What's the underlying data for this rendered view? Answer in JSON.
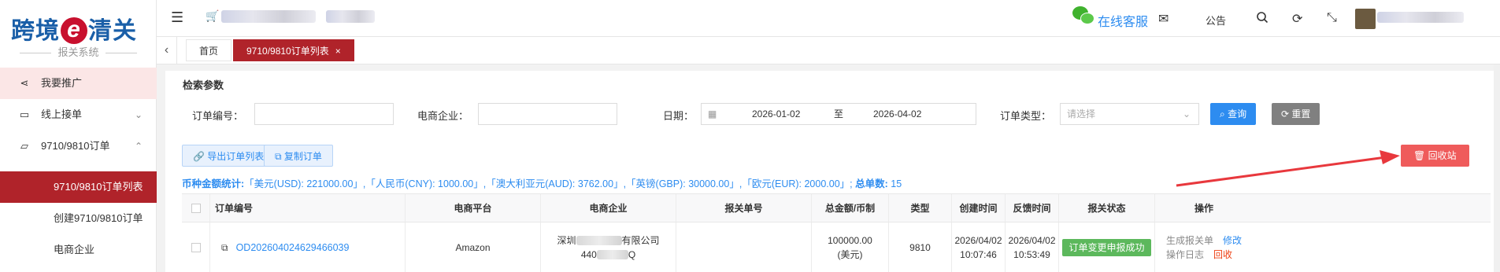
{
  "logo": {
    "name_left": "跨境",
    "name_mark": "e",
    "name_right": "清关",
    "subtitle": "报关系统"
  },
  "header": {
    "menu_icon": "hamburger-icon",
    "cart_icon": "cart-icon",
    "service_label": "在线客服",
    "notice_label": "公告",
    "icons": [
      "mail-icon",
      "search-icon",
      "refresh-icon",
      "fullscreen-icon"
    ]
  },
  "tabs": [
    {
      "label": "首页",
      "active": false
    },
    {
      "label": "9710/9810订单列表",
      "active": true,
      "close": "×"
    }
  ],
  "sidebar": {
    "promo": "我要推广",
    "items": [
      {
        "label": "线上接单",
        "icon": "folder-icon"
      },
      {
        "label": "9710/9810订单",
        "icon": "folder-open-icon"
      }
    ],
    "subitems": [
      "9710/9810订单列表",
      "创建9710/9810订单",
      "电商企业"
    ]
  },
  "search": {
    "title": "检索参数",
    "order_no_label": "订单编号：",
    "order_no_value": "",
    "company_label": "电商企业：",
    "company_value": "",
    "date_label": "日期：",
    "date_from": "2026-01-02",
    "date_sep": "至",
    "date_to": "2026-04-02",
    "type_label": "订单类型：",
    "type_placeholder": "请选择",
    "query_button": "查询",
    "reset_button": "重置"
  },
  "actions": {
    "export_button": "导出订单列表",
    "copy_button": "复制订单",
    "recycle_button": "回收站"
  },
  "stats": {
    "label": "币种金额统计:",
    "text": "「美元(USD): 221000.00」,「人民币(CNY): 1000.00」,「澳大利亚元(AUD): 3762.00」,「英镑(GBP): 30000.00」,「欧元(EUR): 2000.00」;",
    "total_label": "总单数:",
    "total_value": "15"
  },
  "table": {
    "headers": [
      "订单编号",
      "电商平台",
      "电商企业",
      "报关单号",
      "总金额/币制",
      "类型",
      "创建时间",
      "反馈时间",
      "报关状态",
      "操作"
    ],
    "rows": [
      {
        "order_no": "OD202604024629466039",
        "platform": "Amazon",
        "company_prefix": "深圳",
        "company_suffix": "有限公司",
        "company_code_prefix": "440",
        "company_code_suffix": "Q",
        "customs_no": "",
        "amount": "100000.00",
        "currency": "(美元)",
        "type": "9810",
        "created_date": "2026/04/02",
        "created_time": "10:07:46",
        "feedback_date": "2026/04/02",
        "feedback_time": "10:53:49",
        "status": "订单变更申报成功",
        "op_generate": "生成报关单",
        "op_edit": "修改",
        "op_log": "操作日志",
        "op_recycle": "回收"
      }
    ]
  },
  "colors": {
    "brand_red": "#b0232a",
    "link_blue": "#2d8cf0",
    "success_green": "#5cb85c",
    "arrow_red": "#e8383d"
  }
}
